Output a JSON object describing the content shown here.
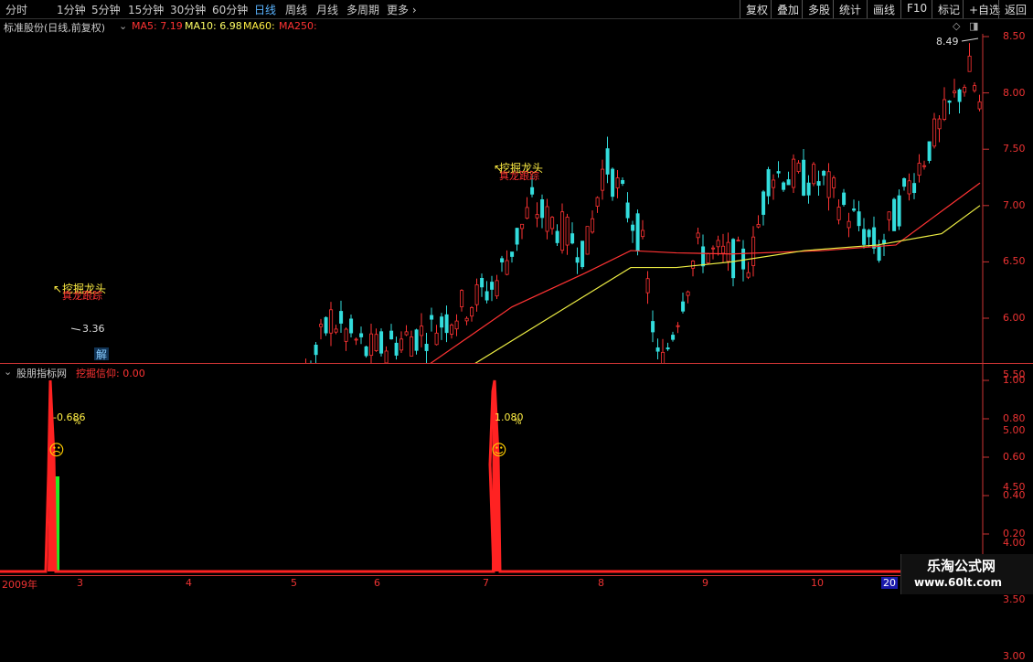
{
  "toolbar": {
    "periods": [
      "分时",
      "1分钟",
      "5分钟",
      "15分钟",
      "30分钟",
      "60分钟",
      "日线",
      "周线",
      "月线",
      "多周期",
      "更多"
    ],
    "active_period": "日线",
    "actions": [
      "复权",
      "叠加",
      "多股",
      "统计",
      "画线",
      "F10",
      "标记",
      "+自选",
      "返回"
    ]
  },
  "main_chart": {
    "title": "标准股份(日线,前复权)",
    "ma5": "MA5: 7.19",
    "ma10": "MA10: 6.98",
    "ma60": "MA60: ",
    "ma250": "MA250: ",
    "colors": {
      "ma5": "#ff3333",
      "ma10": "#ffff66",
      "ma60": "#ff3333",
      "ma250": "#ff3333",
      "up": "#ff3333",
      "down": "#33dddd"
    },
    "y_ticks": [
      "8.50",
      "8.00",
      "7.50",
      "7.00",
      "6.50",
      "6.00",
      "5.50",
      "5.00",
      "4.50",
      "4.00",
      "3.50",
      "3.00"
    ],
    "high_label": "8.49",
    "low_label": "3.36",
    "signal_label_1": "挖掘龙头",
    "signal_sub_1": "真龙跟踪",
    "signal_label_2": "挖掘龙头",
    "signal_sub_2": "真龙跟踪",
    "marker_text": "解"
  },
  "indicator": {
    "name": "股朋指标网",
    "series_label": "挖掘信仰: 0.00",
    "y_ticks": [
      "1.00",
      "0.80",
      "0.60",
      "0.40",
      "0.20"
    ],
    "spike1_value": "-0.686",
    "spike1_suffix": "%",
    "spike2_value": "1.080",
    "spike2_suffix": "%",
    "face1": "☹",
    "face2": "☺",
    "colors": {
      "line": "#ff2222",
      "bar": "#22ee22"
    }
  },
  "x_axis": {
    "labels": [
      "2009年",
      "3",
      "4",
      "5",
      "6",
      "7",
      "8",
      "9",
      "10",
      "20"
    ]
  },
  "watermark": {
    "title": "乐淘公式网",
    "url": "www.60lt.com"
  }
}
